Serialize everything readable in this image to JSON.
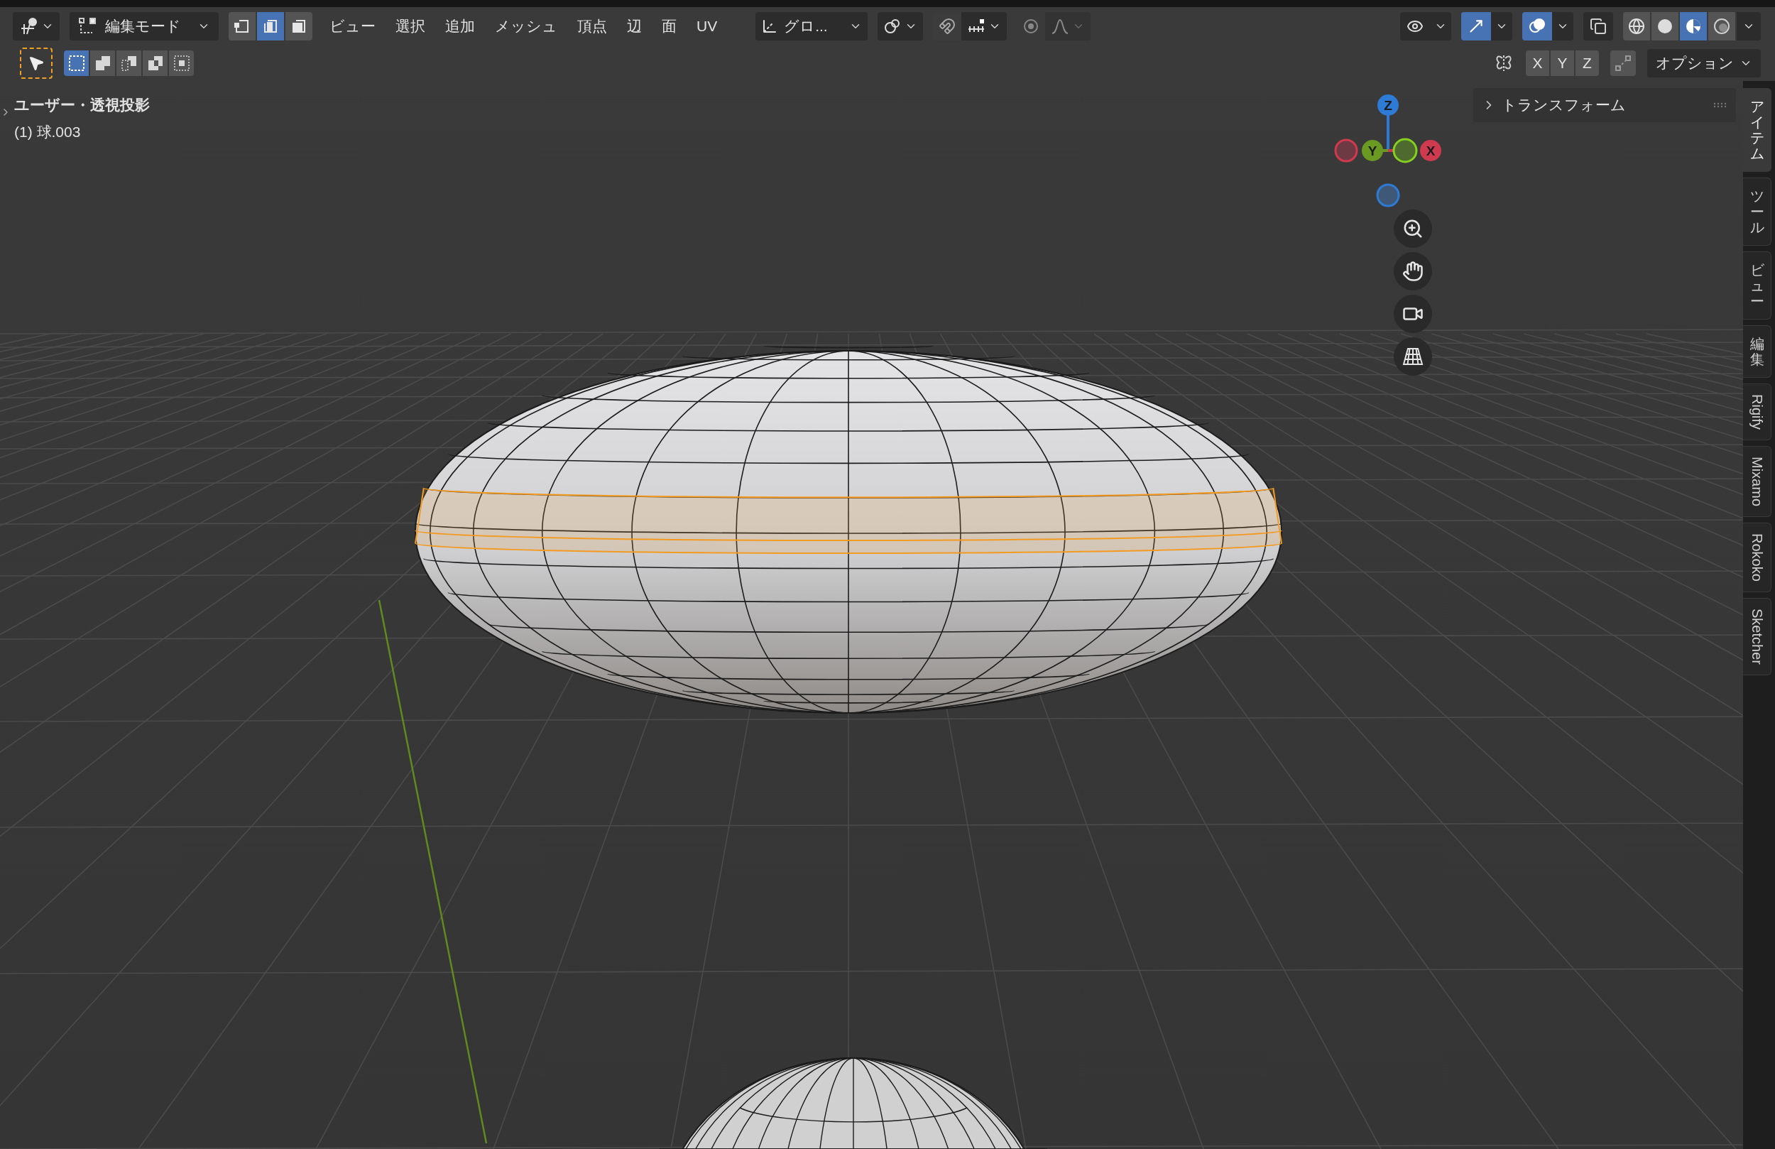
{
  "header": {
    "mode": {
      "label": "編集モード"
    },
    "select_modes": [
      {
        "kind": "vertex",
        "selected": false
      },
      {
        "kind": "edge",
        "selected": true
      },
      {
        "kind": "face",
        "selected": false
      }
    ],
    "menus": [
      "ビュー",
      "選択",
      "追加",
      "メッシュ",
      "頂点",
      "辺",
      "面",
      "UV"
    ],
    "orientation": {
      "label": "グロ..."
    },
    "viewport_toggles": [
      {
        "kind": "visibility",
        "on": false
      },
      {
        "kind": "gizmos",
        "on": true
      },
      {
        "kind": "overlays",
        "on": true
      },
      {
        "kind": "xray",
        "on": false
      }
    ],
    "shading": [
      {
        "kind": "wireframe",
        "selected": false
      },
      {
        "kind": "solid",
        "selected": false
      },
      {
        "kind": "material",
        "selected": true
      },
      {
        "kind": "rendered",
        "selected": false
      }
    ]
  },
  "toolbar": {
    "select_box_modes": [
      {
        "kind": "new",
        "selected": true
      },
      {
        "kind": "extend",
        "selected": false
      },
      {
        "kind": "subtract",
        "selected": false
      },
      {
        "kind": "invert",
        "selected": false
      },
      {
        "kind": "intersect",
        "selected": false
      }
    ],
    "mirror_axes": [
      {
        "label": "X",
        "on": false
      },
      {
        "label": "Y",
        "on": false
      },
      {
        "label": "Z",
        "on": false
      }
    ],
    "options": {
      "label": "オプション"
    }
  },
  "viewport": {
    "view_name": "ユーザー・透視投影",
    "object_name": "(1) 球.003"
  },
  "gizmo": {
    "axes": [
      {
        "label": "Z",
        "color": "#2e7bd6"
      },
      {
        "label": "Y",
        "color": "#6a9a22"
      },
      {
        "label": "X",
        "color": "#d03a4e"
      }
    ]
  },
  "sidebar": {
    "panels": [
      {
        "title": "トランスフォーム",
        "expanded": false
      }
    ],
    "tabs": [
      {
        "label": "アイテム",
        "kind": "cjk",
        "selected": true
      },
      {
        "label": "ツール",
        "kind": "cjk",
        "selected": false
      },
      {
        "label": "ビュー",
        "kind": "cjk",
        "selected": false
      },
      {
        "label": "編集",
        "kind": "cjk",
        "selected": false
      },
      {
        "label": "Rigify",
        "kind": "latin",
        "selected": false
      },
      {
        "label": "Mixamo",
        "kind": "latin",
        "selected": false
      },
      {
        "label": "Rokoko",
        "kind": "latin",
        "selected": false
      },
      {
        "label": "Sketcher",
        "kind": "latin",
        "selected": false
      }
    ]
  }
}
